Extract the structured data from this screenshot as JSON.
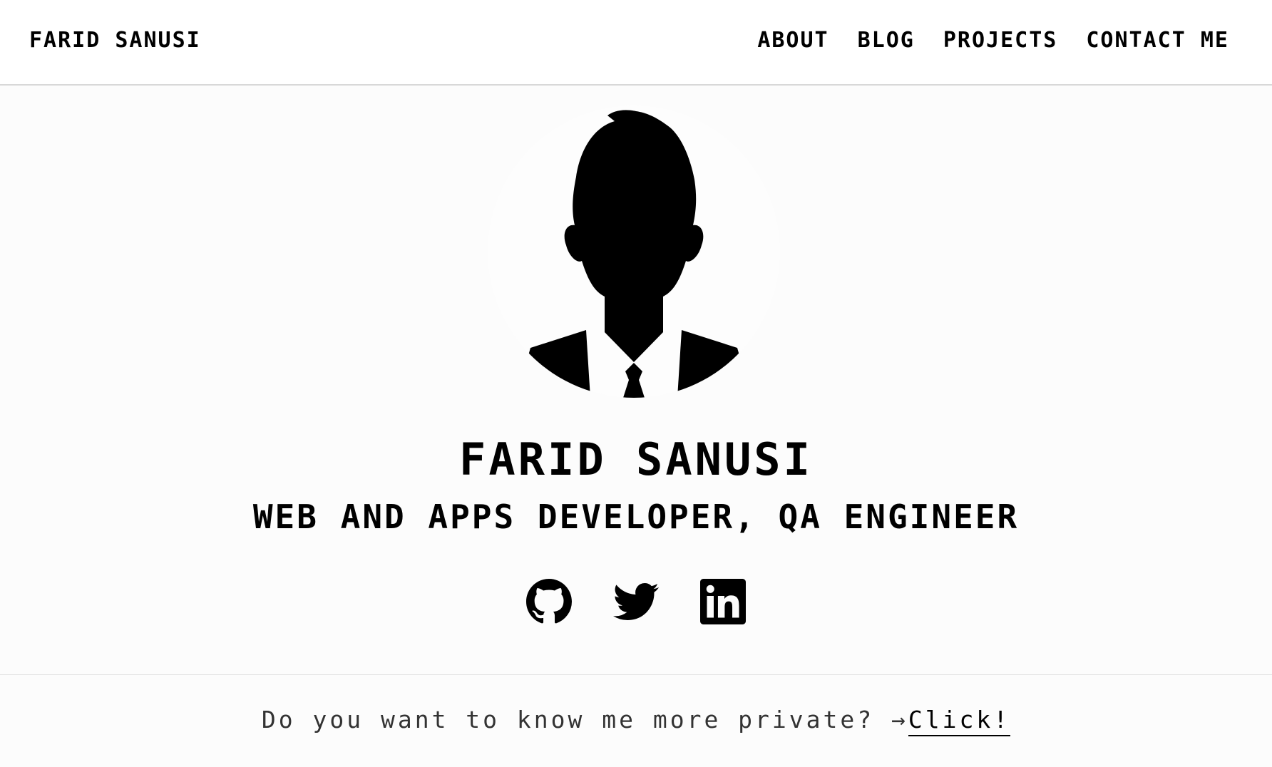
{
  "header": {
    "brand": "FARID SANUSI",
    "nav": [
      {
        "label": "ABOUT"
      },
      {
        "label": "BLOG"
      },
      {
        "label": "PROJECTS"
      },
      {
        "label": "CONTACT ME"
      }
    ]
  },
  "hero": {
    "name": "FARID SANUSI",
    "role": "WEB AND APPS DEVELOPER, QA ENGINEER",
    "avatar_icon": "person-silhouette-icon"
  },
  "socials": [
    {
      "icon": "github-icon"
    },
    {
      "icon": "twitter-icon"
    },
    {
      "icon": "linkedin-icon"
    }
  ],
  "footer": {
    "question": "Do you want to know me more private? ",
    "arrow": "→",
    "link_label": "Click!"
  },
  "colors": {
    "background": "#fcfcfc",
    "header_bg": "#ffffff",
    "text": "#000000",
    "footer_text": "#333333",
    "divider": "#d8d8d8"
  }
}
